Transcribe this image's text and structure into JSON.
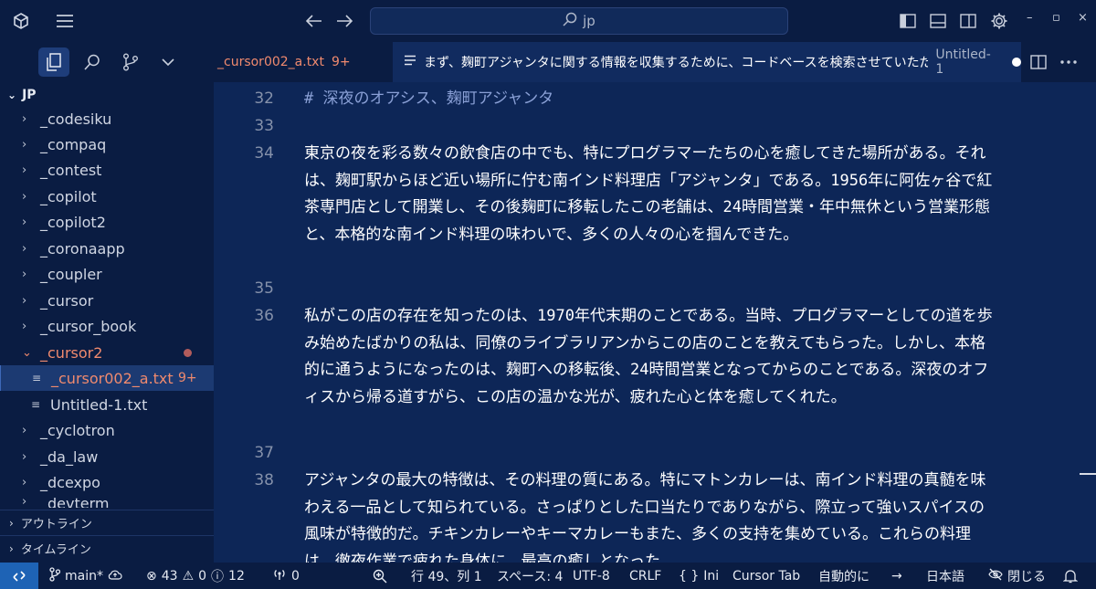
{
  "titlebar": {
    "search_text": "jp",
    "minimize": "–",
    "restore": "▫",
    "close": "×"
  },
  "tabs": {
    "active_name": "_cursor002_a.txt",
    "active_badge": "9+",
    "chat_title": "まず、麹町アジャンタに関する情報を収集するために、コードベースを検索させていただ",
    "chat_file": "Untitled-1"
  },
  "sidebar": {
    "root": "JP",
    "items": [
      {
        "label": "_codesiku"
      },
      {
        "label": "_compaq"
      },
      {
        "label": "_contest"
      },
      {
        "label": "_copilot"
      },
      {
        "label": "_copilot2"
      },
      {
        "label": "_coronaapp"
      },
      {
        "label": "_coupler"
      },
      {
        "label": "_cursor"
      },
      {
        "label": "_cursor_book"
      },
      {
        "label": "_cursor2"
      },
      {
        "label": "_cursor002_a.txt",
        "badge": "9+"
      },
      {
        "label": "Untitled-1.txt"
      },
      {
        "label": "_cyclotron"
      },
      {
        "label": "_da_law"
      },
      {
        "label": "_dcexpo"
      },
      {
        "label": "_devterm"
      }
    ],
    "outline": "アウトライン",
    "timeline": "タイムライン"
  },
  "editor": {
    "lines": [
      {
        "num": "32",
        "text": "# 深夜のオアシス、麹町アジャンタ"
      },
      {
        "num": "33",
        "text": ""
      },
      {
        "num": "34",
        "text": "東京の夜を彩る数々の飲食店の中でも、特にプログラマーたちの心を癒してきた場所がある。それは、麹町駅からほど近い場所に佇む南インド料理店「アジャンタ」である。1956年に阿佐ヶ谷で紅茶専門店として開業し、その後麹町に移転したこの老舗は、24時間営業・年中無休という営業形態と、本格的な南インド料理の味わいで、多くの人々の心を掴んできた。"
      },
      {
        "num": "35",
        "text": ""
      },
      {
        "num": "36",
        "text": "私がこの店の存在を知ったのは、1970年代末期のことである。当時、プログラマーとしての道を歩み始めたばかりの私は、同僚のライブラリアンからこの店のことを教えてもらった。しかし、本格的に通うようになったのは、麹町への移転後、24時間営業となってからのことである。深夜のオフィスから帰る道すがら、この店の温かな光が、疲れた心と体を癒してくれた。"
      },
      {
        "num": "37",
        "text": ""
      },
      {
        "num": "38",
        "text": "アジャンタの最大の特徴は、その料理の質にある。特にマトンカレーは、南インド料理の真髄を味わえる一品として知られている。さっぱりとした口当たりでありながら、際立って強いスパイスの風味が特徴的だ。チキンカレーやキーマカレーもまた、多くの支持を集めている。これらの料理は、徹夜作業で疲れた身体に、最高の癒しとなった。"
      }
    ]
  },
  "statusbar": {
    "branch": "main*",
    "errors": "43",
    "warnings": "0",
    "infos": "12",
    "ports": "0",
    "position": "行 49、列 1",
    "spaces": "スペース: 4",
    "encoding": "UTF-8",
    "eol": "CRLF",
    "language": "Ini",
    "cursor_tab": "Cursor Tab",
    "auto": "自動的に",
    "locale": "日本語",
    "close": "閉じる"
  }
}
